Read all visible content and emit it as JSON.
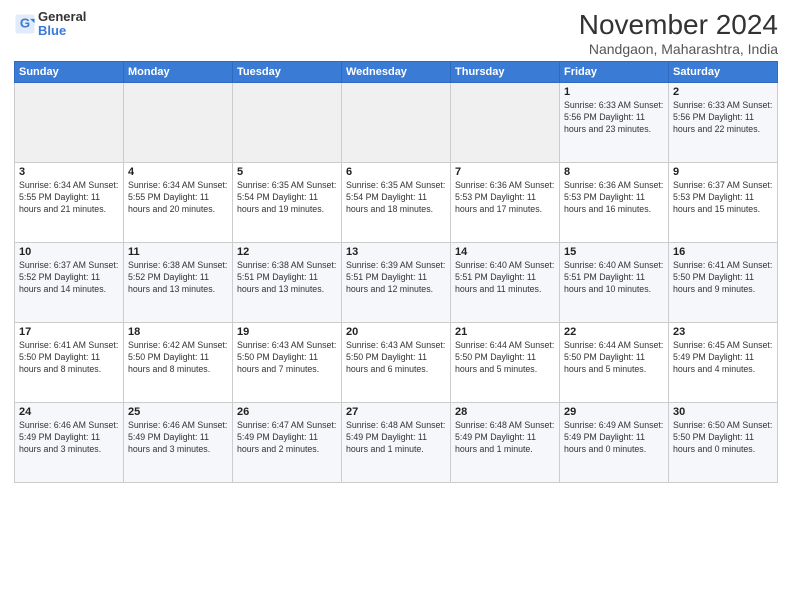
{
  "header": {
    "logo_general": "General",
    "logo_blue": "Blue",
    "month_title": "November 2024",
    "location": "Nandgaon, Maharashtra, India"
  },
  "days_of_week": [
    "Sunday",
    "Monday",
    "Tuesday",
    "Wednesday",
    "Thursday",
    "Friday",
    "Saturday"
  ],
  "weeks": [
    [
      {
        "day": "",
        "info": ""
      },
      {
        "day": "",
        "info": ""
      },
      {
        "day": "",
        "info": ""
      },
      {
        "day": "",
        "info": ""
      },
      {
        "day": "",
        "info": ""
      },
      {
        "day": "1",
        "info": "Sunrise: 6:33 AM\nSunset: 5:56 PM\nDaylight: 11 hours and 23 minutes."
      },
      {
        "day": "2",
        "info": "Sunrise: 6:33 AM\nSunset: 5:56 PM\nDaylight: 11 hours and 22 minutes."
      }
    ],
    [
      {
        "day": "3",
        "info": "Sunrise: 6:34 AM\nSunset: 5:55 PM\nDaylight: 11 hours and 21 minutes."
      },
      {
        "day": "4",
        "info": "Sunrise: 6:34 AM\nSunset: 5:55 PM\nDaylight: 11 hours and 20 minutes."
      },
      {
        "day": "5",
        "info": "Sunrise: 6:35 AM\nSunset: 5:54 PM\nDaylight: 11 hours and 19 minutes."
      },
      {
        "day": "6",
        "info": "Sunrise: 6:35 AM\nSunset: 5:54 PM\nDaylight: 11 hours and 18 minutes."
      },
      {
        "day": "7",
        "info": "Sunrise: 6:36 AM\nSunset: 5:53 PM\nDaylight: 11 hours and 17 minutes."
      },
      {
        "day": "8",
        "info": "Sunrise: 6:36 AM\nSunset: 5:53 PM\nDaylight: 11 hours and 16 minutes."
      },
      {
        "day": "9",
        "info": "Sunrise: 6:37 AM\nSunset: 5:53 PM\nDaylight: 11 hours and 15 minutes."
      }
    ],
    [
      {
        "day": "10",
        "info": "Sunrise: 6:37 AM\nSunset: 5:52 PM\nDaylight: 11 hours and 14 minutes."
      },
      {
        "day": "11",
        "info": "Sunrise: 6:38 AM\nSunset: 5:52 PM\nDaylight: 11 hours and 13 minutes."
      },
      {
        "day": "12",
        "info": "Sunrise: 6:38 AM\nSunset: 5:51 PM\nDaylight: 11 hours and 13 minutes."
      },
      {
        "day": "13",
        "info": "Sunrise: 6:39 AM\nSunset: 5:51 PM\nDaylight: 11 hours and 12 minutes."
      },
      {
        "day": "14",
        "info": "Sunrise: 6:40 AM\nSunset: 5:51 PM\nDaylight: 11 hours and 11 minutes."
      },
      {
        "day": "15",
        "info": "Sunrise: 6:40 AM\nSunset: 5:51 PM\nDaylight: 11 hours and 10 minutes."
      },
      {
        "day": "16",
        "info": "Sunrise: 6:41 AM\nSunset: 5:50 PM\nDaylight: 11 hours and 9 minutes."
      }
    ],
    [
      {
        "day": "17",
        "info": "Sunrise: 6:41 AM\nSunset: 5:50 PM\nDaylight: 11 hours and 8 minutes."
      },
      {
        "day": "18",
        "info": "Sunrise: 6:42 AM\nSunset: 5:50 PM\nDaylight: 11 hours and 8 minutes."
      },
      {
        "day": "19",
        "info": "Sunrise: 6:43 AM\nSunset: 5:50 PM\nDaylight: 11 hours and 7 minutes."
      },
      {
        "day": "20",
        "info": "Sunrise: 6:43 AM\nSunset: 5:50 PM\nDaylight: 11 hours and 6 minutes."
      },
      {
        "day": "21",
        "info": "Sunrise: 6:44 AM\nSunset: 5:50 PM\nDaylight: 11 hours and 5 minutes."
      },
      {
        "day": "22",
        "info": "Sunrise: 6:44 AM\nSunset: 5:50 PM\nDaylight: 11 hours and 5 minutes."
      },
      {
        "day": "23",
        "info": "Sunrise: 6:45 AM\nSunset: 5:49 PM\nDaylight: 11 hours and 4 minutes."
      }
    ],
    [
      {
        "day": "24",
        "info": "Sunrise: 6:46 AM\nSunset: 5:49 PM\nDaylight: 11 hours and 3 minutes."
      },
      {
        "day": "25",
        "info": "Sunrise: 6:46 AM\nSunset: 5:49 PM\nDaylight: 11 hours and 3 minutes."
      },
      {
        "day": "26",
        "info": "Sunrise: 6:47 AM\nSunset: 5:49 PM\nDaylight: 11 hours and 2 minutes."
      },
      {
        "day": "27",
        "info": "Sunrise: 6:48 AM\nSunset: 5:49 PM\nDaylight: 11 hours and 1 minute."
      },
      {
        "day": "28",
        "info": "Sunrise: 6:48 AM\nSunset: 5:49 PM\nDaylight: 11 hours and 1 minute."
      },
      {
        "day": "29",
        "info": "Sunrise: 6:49 AM\nSunset: 5:49 PM\nDaylight: 11 hours and 0 minutes."
      },
      {
        "day": "30",
        "info": "Sunrise: 6:50 AM\nSunset: 5:50 PM\nDaylight: 11 hours and 0 minutes."
      }
    ]
  ]
}
